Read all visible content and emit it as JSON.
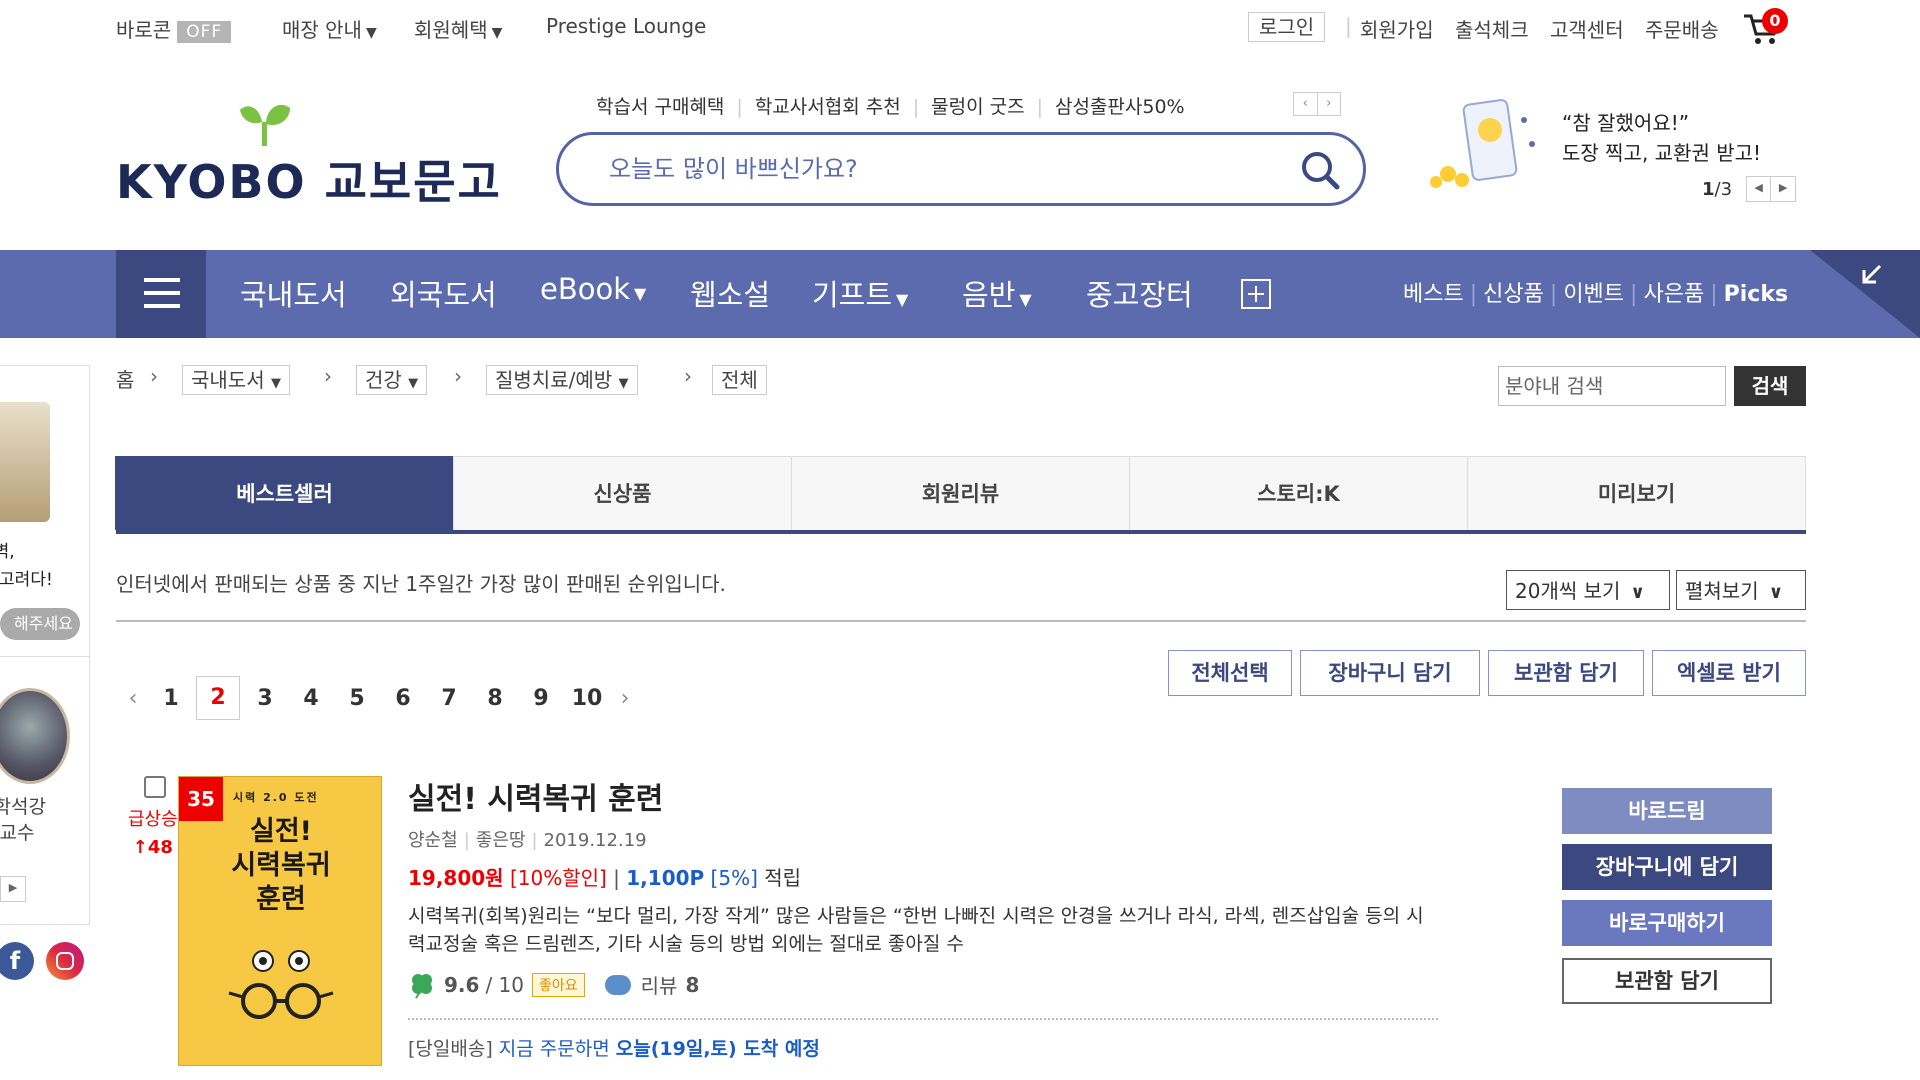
{
  "topbar": {
    "baro_label": "바로콘",
    "baro_state": "OFF",
    "store_info": "매장 안내",
    "member_benefit": "회원혜택",
    "prestige": "Prestige Lounge",
    "login": "로그인",
    "signup": "회원가입",
    "attendance": "출석체크",
    "customer_center": "고객센터",
    "order_delivery": "주문배송",
    "cart_count": "0"
  },
  "header": {
    "logo_text": "KYOBO 교보문고",
    "promo_links": [
      "학습서 구매혜택",
      "학교사서협회 추천",
      "물렁이 굿즈",
      "삼성출판사50%"
    ],
    "search_placeholder": "오늘도 많이 바쁘신가요?",
    "banner_line1": "“참 잘했어요!”",
    "banner_line2": "도장 찍고, 교환권 받고!",
    "banner_page_current": "1",
    "banner_page_total": "/3"
  },
  "nav": {
    "items": [
      "국내도서",
      "외국도서",
      "eBook",
      "웹소설",
      "기프트",
      "음반",
      "중고장터"
    ],
    "right_links": [
      "베스트",
      "신상품",
      "이벤트",
      "사은품",
      "Picks"
    ]
  },
  "sidebar": {
    "text1_line1": "시벽,",
    "text1_line2": "엔 고려다!",
    "button": "해주세요",
    "text2_line1": "문학석강",
    "text2_line2": "소 교수"
  },
  "breadcrumb": {
    "home": "홈",
    "level1": "국내도서",
    "level2": "건강",
    "level3": "질병치료/예방",
    "level4": "전체"
  },
  "field_search": {
    "placeholder": "분야내 검색",
    "button": "검색"
  },
  "tabs": [
    "베스트셀러",
    "신상품",
    "회원리뷰",
    "스토리:K",
    "미리보기"
  ],
  "list_desc": "인터넷에서 판매되는 상품 중 지난 1주일간 가장 많이 판매된 순위입니다.",
  "view_count_select": "20개씩 보기",
  "view_mode_select": "펼쳐보기",
  "pagination": {
    "pages": [
      "1",
      "2",
      "3",
      "4",
      "5",
      "6",
      "7",
      "8",
      "9",
      "10"
    ],
    "current": "2"
  },
  "actions": [
    "전체선택",
    "장바구니 담기",
    "보관함 담기",
    "엑셀로 받기"
  ],
  "product": {
    "rank": "35",
    "rank_change_label": "급상승",
    "rank_change_value": "48",
    "cover_top": "시력 2.0 도전",
    "cover_title_line1": "실전!",
    "cover_title_line2": "시력복귀",
    "cover_title_line3": "훈련",
    "title": "실전! 시력복귀 훈련",
    "author": "양순철",
    "publisher": "좋은땅",
    "date": "2019.12.19",
    "price": "19,800원",
    "discount": "[10%할인]",
    "points": "1,100P",
    "points_rate": "[5%]",
    "points_suffix": "적립",
    "summary": "시력복귀(회복)원리는 “보다 멀리, 가장 작게” 많은 사람들은 “한번 나빠진 시력은 안경을 쓰거나 라식, 라섹, 렌즈삽입술 등의 시력교정술 혹은 드림렌즈, 기타 시술 등의 방법 외에는 절대로 좋아질 수",
    "rating": "9.6",
    "rating_max": "/ 10",
    "like_badge": "좋아요",
    "review_label": "리뷰",
    "review_count": "8",
    "delivery_tag": "[당일배송]",
    "delivery_text1": "지금 주문하면",
    "delivery_text2": "오늘(19일,토) 도착 예정"
  },
  "right_buttons": [
    "바로드림",
    "장바구니에 담기",
    "바로구매하기",
    "보관함 담기"
  ],
  "colors": {
    "brand_nav": "#5b6bae",
    "brand_dark": "#3c4880",
    "accent_red": "#e00000",
    "link_blue": "#1a5cc8"
  }
}
